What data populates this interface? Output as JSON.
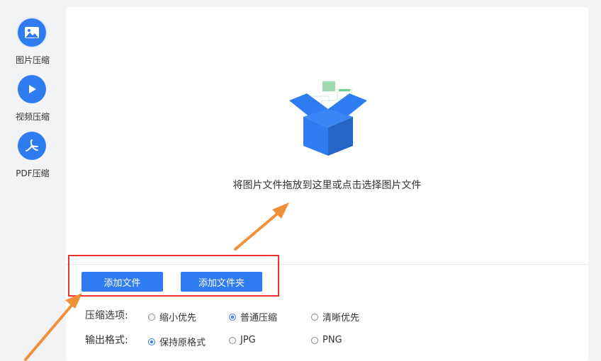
{
  "sidebar": {
    "items": [
      {
        "label": "图片压缩",
        "icon": "image-icon",
        "active": true
      },
      {
        "label": "视频压缩",
        "icon": "play-icon",
        "active": false
      },
      {
        "label": "PDF压缩",
        "icon": "pdf-icon",
        "active": false
      }
    ]
  },
  "drop_zone": {
    "text": "将图片文件拖放到这里或点击选择图片文件",
    "icon": "open-box-icon"
  },
  "buttons": {
    "add_file": "添加文件",
    "add_folder": "添加文件夹"
  },
  "compress_options": {
    "label": "压缩选项:",
    "options": [
      "缩小优先",
      "普通压缩",
      "清晰优先"
    ],
    "selected": "普通压缩"
  },
  "output_format": {
    "label": "输出格式:",
    "options": [
      "保持原格式",
      "JPG",
      "PNG"
    ],
    "selected": "保持原格式"
  },
  "colors": {
    "accent": "#2f7cf0",
    "highlight": "#e33333",
    "arrow": "#f0913a"
  }
}
